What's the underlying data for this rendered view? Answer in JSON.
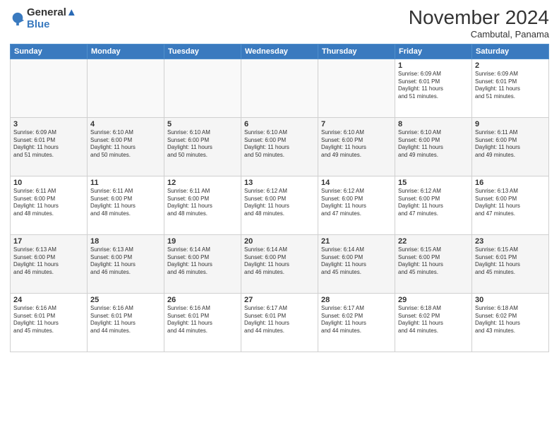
{
  "logo": {
    "line1": "General",
    "line2": "Blue"
  },
  "title": "November 2024",
  "subtitle": "Cambutal, Panama",
  "days_of_week": [
    "Sunday",
    "Monday",
    "Tuesday",
    "Wednesday",
    "Thursday",
    "Friday",
    "Saturday"
  ],
  "weeks": [
    [
      {
        "day": "",
        "info": ""
      },
      {
        "day": "",
        "info": ""
      },
      {
        "day": "",
        "info": ""
      },
      {
        "day": "",
        "info": ""
      },
      {
        "day": "",
        "info": ""
      },
      {
        "day": "1",
        "info": "Sunrise: 6:09 AM\nSunset: 6:01 PM\nDaylight: 11 hours\nand 51 minutes."
      },
      {
        "day": "2",
        "info": "Sunrise: 6:09 AM\nSunset: 6:01 PM\nDaylight: 11 hours\nand 51 minutes."
      }
    ],
    [
      {
        "day": "3",
        "info": "Sunrise: 6:09 AM\nSunset: 6:01 PM\nDaylight: 11 hours\nand 51 minutes."
      },
      {
        "day": "4",
        "info": "Sunrise: 6:10 AM\nSunset: 6:00 PM\nDaylight: 11 hours\nand 50 minutes."
      },
      {
        "day": "5",
        "info": "Sunrise: 6:10 AM\nSunset: 6:00 PM\nDaylight: 11 hours\nand 50 minutes."
      },
      {
        "day": "6",
        "info": "Sunrise: 6:10 AM\nSunset: 6:00 PM\nDaylight: 11 hours\nand 50 minutes."
      },
      {
        "day": "7",
        "info": "Sunrise: 6:10 AM\nSunset: 6:00 PM\nDaylight: 11 hours\nand 49 minutes."
      },
      {
        "day": "8",
        "info": "Sunrise: 6:10 AM\nSunset: 6:00 PM\nDaylight: 11 hours\nand 49 minutes."
      },
      {
        "day": "9",
        "info": "Sunrise: 6:11 AM\nSunset: 6:00 PM\nDaylight: 11 hours\nand 49 minutes."
      }
    ],
    [
      {
        "day": "10",
        "info": "Sunrise: 6:11 AM\nSunset: 6:00 PM\nDaylight: 11 hours\nand 48 minutes."
      },
      {
        "day": "11",
        "info": "Sunrise: 6:11 AM\nSunset: 6:00 PM\nDaylight: 11 hours\nand 48 minutes."
      },
      {
        "day": "12",
        "info": "Sunrise: 6:11 AM\nSunset: 6:00 PM\nDaylight: 11 hours\nand 48 minutes."
      },
      {
        "day": "13",
        "info": "Sunrise: 6:12 AM\nSunset: 6:00 PM\nDaylight: 11 hours\nand 48 minutes."
      },
      {
        "day": "14",
        "info": "Sunrise: 6:12 AM\nSunset: 6:00 PM\nDaylight: 11 hours\nand 47 minutes."
      },
      {
        "day": "15",
        "info": "Sunrise: 6:12 AM\nSunset: 6:00 PM\nDaylight: 11 hours\nand 47 minutes."
      },
      {
        "day": "16",
        "info": "Sunrise: 6:13 AM\nSunset: 6:00 PM\nDaylight: 11 hours\nand 47 minutes."
      }
    ],
    [
      {
        "day": "17",
        "info": "Sunrise: 6:13 AM\nSunset: 6:00 PM\nDaylight: 11 hours\nand 46 minutes."
      },
      {
        "day": "18",
        "info": "Sunrise: 6:13 AM\nSunset: 6:00 PM\nDaylight: 11 hours\nand 46 minutes."
      },
      {
        "day": "19",
        "info": "Sunrise: 6:14 AM\nSunset: 6:00 PM\nDaylight: 11 hours\nand 46 minutes."
      },
      {
        "day": "20",
        "info": "Sunrise: 6:14 AM\nSunset: 6:00 PM\nDaylight: 11 hours\nand 46 minutes."
      },
      {
        "day": "21",
        "info": "Sunrise: 6:14 AM\nSunset: 6:00 PM\nDaylight: 11 hours\nand 45 minutes."
      },
      {
        "day": "22",
        "info": "Sunrise: 6:15 AM\nSunset: 6:00 PM\nDaylight: 11 hours\nand 45 minutes."
      },
      {
        "day": "23",
        "info": "Sunrise: 6:15 AM\nSunset: 6:01 PM\nDaylight: 11 hours\nand 45 minutes."
      }
    ],
    [
      {
        "day": "24",
        "info": "Sunrise: 6:16 AM\nSunset: 6:01 PM\nDaylight: 11 hours\nand 45 minutes."
      },
      {
        "day": "25",
        "info": "Sunrise: 6:16 AM\nSunset: 6:01 PM\nDaylight: 11 hours\nand 44 minutes."
      },
      {
        "day": "26",
        "info": "Sunrise: 6:16 AM\nSunset: 6:01 PM\nDaylight: 11 hours\nand 44 minutes."
      },
      {
        "day": "27",
        "info": "Sunrise: 6:17 AM\nSunset: 6:01 PM\nDaylight: 11 hours\nand 44 minutes."
      },
      {
        "day": "28",
        "info": "Sunrise: 6:17 AM\nSunset: 6:02 PM\nDaylight: 11 hours\nand 44 minutes."
      },
      {
        "day": "29",
        "info": "Sunrise: 6:18 AM\nSunset: 6:02 PM\nDaylight: 11 hours\nand 44 minutes."
      },
      {
        "day": "30",
        "info": "Sunrise: 6:18 AM\nSunset: 6:02 PM\nDaylight: 11 hours\nand 43 minutes."
      }
    ]
  ]
}
